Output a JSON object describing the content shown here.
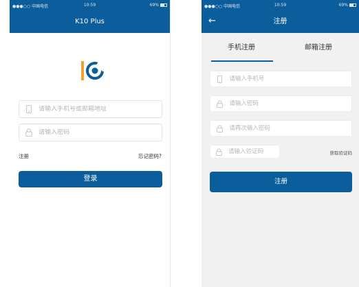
{
  "login": {
    "status": {
      "carrier": "●●●○○ 中国电信",
      "time": "10:59",
      "battery": "69%"
    },
    "title": "K10 Plus",
    "account_placeholder": "请输入手机号或邮箱地址",
    "password_placeholder": "请输入密码",
    "register_link": "注册",
    "forgot_link": "忘记密码?",
    "login_button": "登录",
    "colors": {
      "brand": "#0b5d9c",
      "logo_orange": "#f0a030"
    }
  },
  "register": {
    "status": {
      "carrier": "●●●○○ 中国电信",
      "time": "10:59",
      "battery": "69%"
    },
    "title": "注册",
    "tabs": [
      "手机注册",
      "邮箱注册"
    ],
    "phone_placeholder": "请输入手机号",
    "password_placeholder": "请输入密码",
    "confirm_placeholder": "请再次输入密码",
    "code_placeholder": "请输入验证码",
    "get_code": "获取验证码",
    "submit_button": "注册"
  }
}
